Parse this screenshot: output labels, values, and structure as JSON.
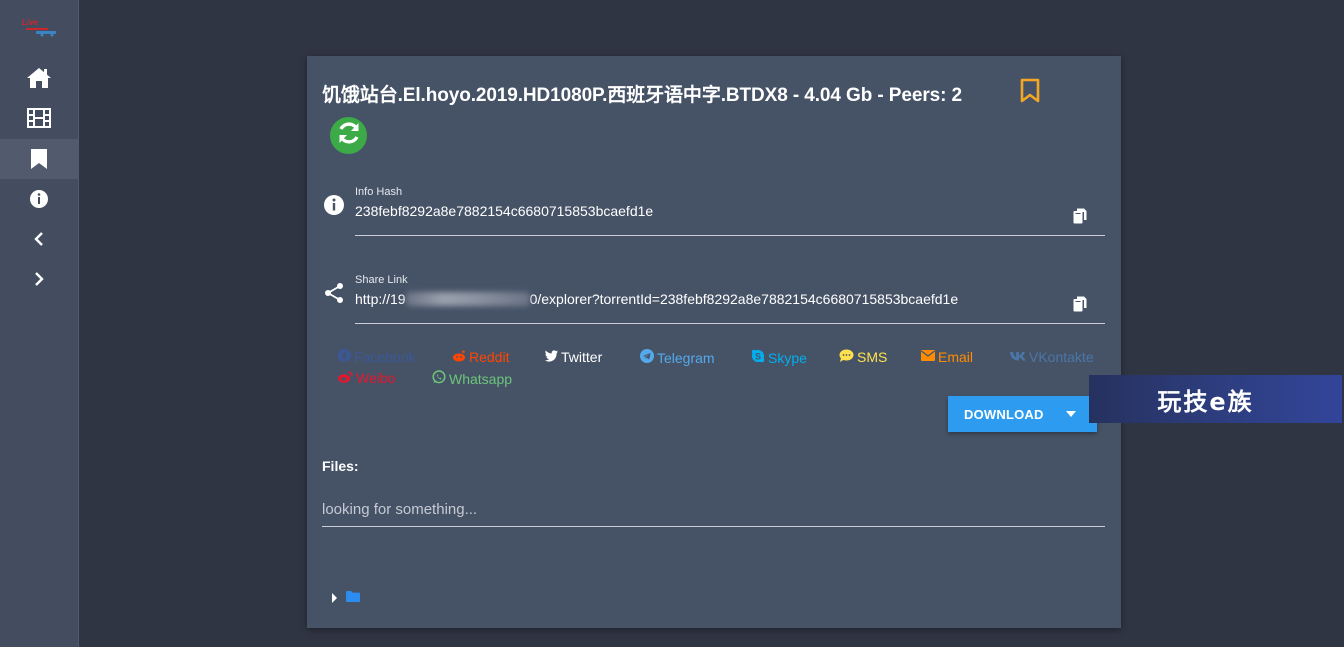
{
  "sidebar": {
    "logo": "logo",
    "items": [
      {
        "icon": "home-icon",
        "active": false
      },
      {
        "icon": "film-icon",
        "active": false
      },
      {
        "icon": "bookmark-icon",
        "active": true
      },
      {
        "icon": "info-icon",
        "active": false
      },
      {
        "icon": "chevron-left-icon",
        "active": false
      },
      {
        "icon": "chevron-right-icon",
        "active": false
      }
    ]
  },
  "torrent": {
    "title": "饥饿站台.El.hoyo.2019.HD1080P.西班牙语中字.BTDX8 - 4.04 Gb - Peers: 2",
    "bookmark_color": "#f5a623",
    "refresh_color": "#3daa48"
  },
  "info_hash": {
    "label": "Info Hash",
    "value": "238febf8292a8e7882154c6680715853bcaefd1e"
  },
  "share_link": {
    "label": "Share Link",
    "prefix": "http://19",
    "suffix": "0/explorer?torrentId=238febf8292a8e7882154c6680715853bcaefd1e"
  },
  "share_buttons": [
    {
      "label": "Facebook",
      "color": "#3b5998",
      "icon": "facebook-icon"
    },
    {
      "label": "Reddit",
      "color": "#ff4500",
      "icon": "reddit-icon"
    },
    {
      "label": "Twitter",
      "color": "#ffffff",
      "icon": "twitter-icon"
    },
    {
      "label": "Telegram",
      "color": "#54a9eb",
      "icon": "telegram-icon"
    },
    {
      "label": "Skype",
      "color": "#00aff0",
      "icon": "skype-icon"
    },
    {
      "label": "SMS",
      "color": "#ffe14d",
      "icon": "sms-icon"
    },
    {
      "label": "Email",
      "color": "#ff8c00",
      "icon": "email-icon"
    },
    {
      "label": "VKontakte",
      "color": "#4a76a8",
      "icon": "vk-icon"
    },
    {
      "label": "Weibo",
      "color": "#e6162d",
      "icon": "weibo-icon"
    },
    {
      "label": "Whatsapp",
      "color": "#6cc57a",
      "icon": "whatsapp-icon"
    }
  ],
  "download": {
    "label": "DOWNLOAD",
    "color": "#2d9cf0"
  },
  "files": {
    "label": "Files:",
    "search_placeholder": "looking for something..."
  },
  "watermark": {
    "text": "玩技e族"
  }
}
